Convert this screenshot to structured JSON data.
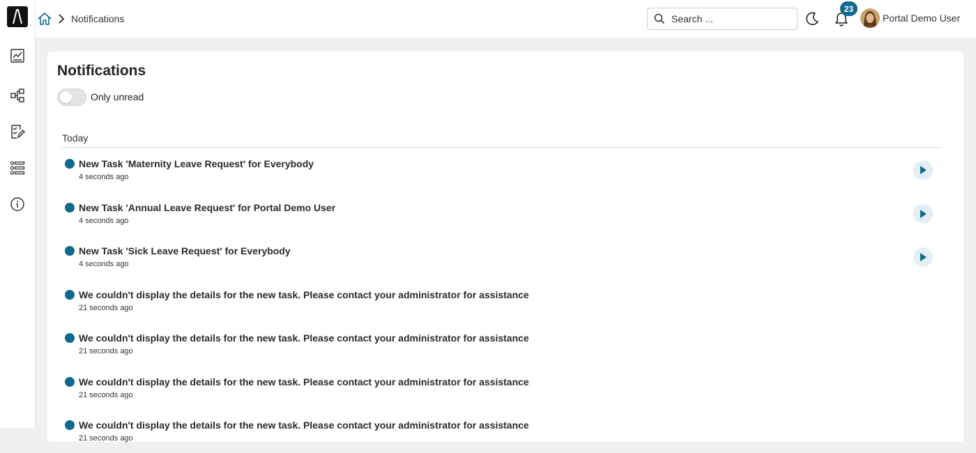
{
  "colors": {
    "accent": "#0d6a8c",
    "background": "#f0f0f0"
  },
  "header": {
    "breadcrumb": "Notifications",
    "search_placeholder": "Search ...",
    "notification_count": "23",
    "user_name": "Portal Demo User"
  },
  "sidebar": {
    "icons": [
      "process-chart-icon",
      "workflow-icon",
      "task-checklist-icon",
      "list-icon",
      "info-icon"
    ]
  },
  "main": {
    "title": "Notifications",
    "toggle_label": "Only unread",
    "toggle_on": false,
    "section_label": "Today",
    "notifications": [
      {
        "title": "New Task 'Maternity Leave Request' for Everybody",
        "time": "4 seconds ago",
        "has_action": true
      },
      {
        "title": "New Task 'Annual Leave Request' for Portal Demo User",
        "time": "4 seconds ago",
        "has_action": true
      },
      {
        "title": "New Task 'Sick Leave Request' for Everybody",
        "time": "4 seconds ago",
        "has_action": true
      },
      {
        "title": "We couldn't display the details for the new task. Please contact your administrator for assistance",
        "time": "21 seconds ago",
        "has_action": false
      },
      {
        "title": "We couldn't display the details for the new task. Please contact your administrator for assistance",
        "time": "21 seconds ago",
        "has_action": false
      },
      {
        "title": "We couldn't display the details for the new task. Please contact your administrator for assistance",
        "time": "21 seconds ago",
        "has_action": false
      },
      {
        "title": "We couldn't display the details for the new task. Please contact your administrator for assistance",
        "time": "21 seconds ago",
        "has_action": false
      }
    ]
  }
}
